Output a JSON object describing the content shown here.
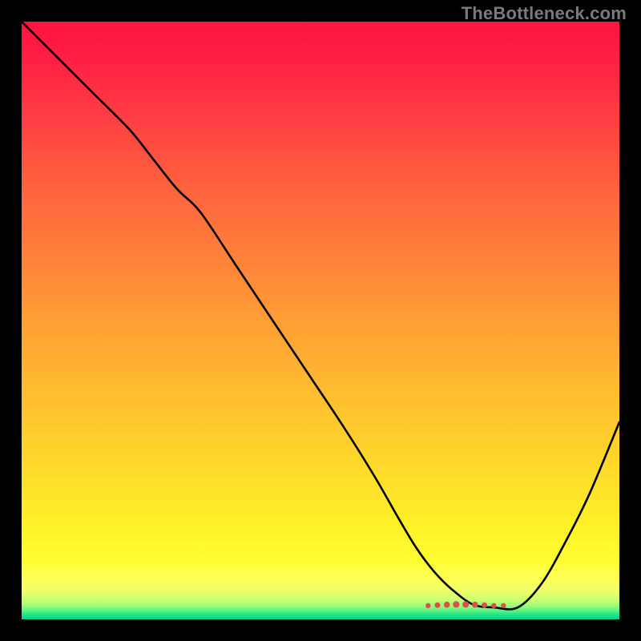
{
  "watermark": "TheBottleneck.com",
  "gradient_stops": [
    {
      "offset": 0.0,
      "color": "#ff1440"
    },
    {
      "offset": 0.06,
      "color": "#ff1e44"
    },
    {
      "offset": 0.15,
      "color": "#ff3a44"
    },
    {
      "offset": 0.25,
      "color": "#ff5a3e"
    },
    {
      "offset": 0.38,
      "color": "#ff7d3a"
    },
    {
      "offset": 0.5,
      "color": "#ff9e34"
    },
    {
      "offset": 0.62,
      "color": "#ffbd2f"
    },
    {
      "offset": 0.74,
      "color": "#ffd82a"
    },
    {
      "offset": 0.84,
      "color": "#fff028"
    },
    {
      "offset": 0.9,
      "color": "#ffff30"
    },
    {
      "offset": 0.935,
      "color": "#fdff5a"
    },
    {
      "offset": 0.955,
      "color": "#e8ff6a"
    },
    {
      "offset": 0.968,
      "color": "#c8ff70"
    },
    {
      "offset": 0.978,
      "color": "#97fc78"
    },
    {
      "offset": 0.986,
      "color": "#55f282"
    },
    {
      "offset": 0.993,
      "color": "#1be48a"
    },
    {
      "offset": 1.0,
      "color": "#00d68c"
    }
  ],
  "chart_data": {
    "type": "line",
    "title": "",
    "xlabel": "",
    "ylabel": "",
    "xlim": [
      0,
      100
    ],
    "ylim": [
      0,
      100
    ],
    "series": [
      {
        "name": "bottleneck-curve",
        "x": [
          0,
          6,
          12,
          18,
          22,
          26,
          30,
          36,
          42,
          48,
          54,
          59,
          63,
          66,
          69,
          72,
          75.5,
          79,
          83,
          87,
          91,
          95,
          100
        ],
        "y": [
          100,
          94,
          88,
          82,
          77,
          72,
          68,
          59,
          50,
          41,
          32,
          24,
          17,
          12,
          8,
          5,
          2.5,
          2,
          2,
          6,
          13,
          21,
          33
        ]
      }
    ],
    "highlight": {
      "name": "optimal-range-marker",
      "x_start": 68,
      "x_end": 79,
      "y": 2.3,
      "color": "#d6534b"
    }
  }
}
